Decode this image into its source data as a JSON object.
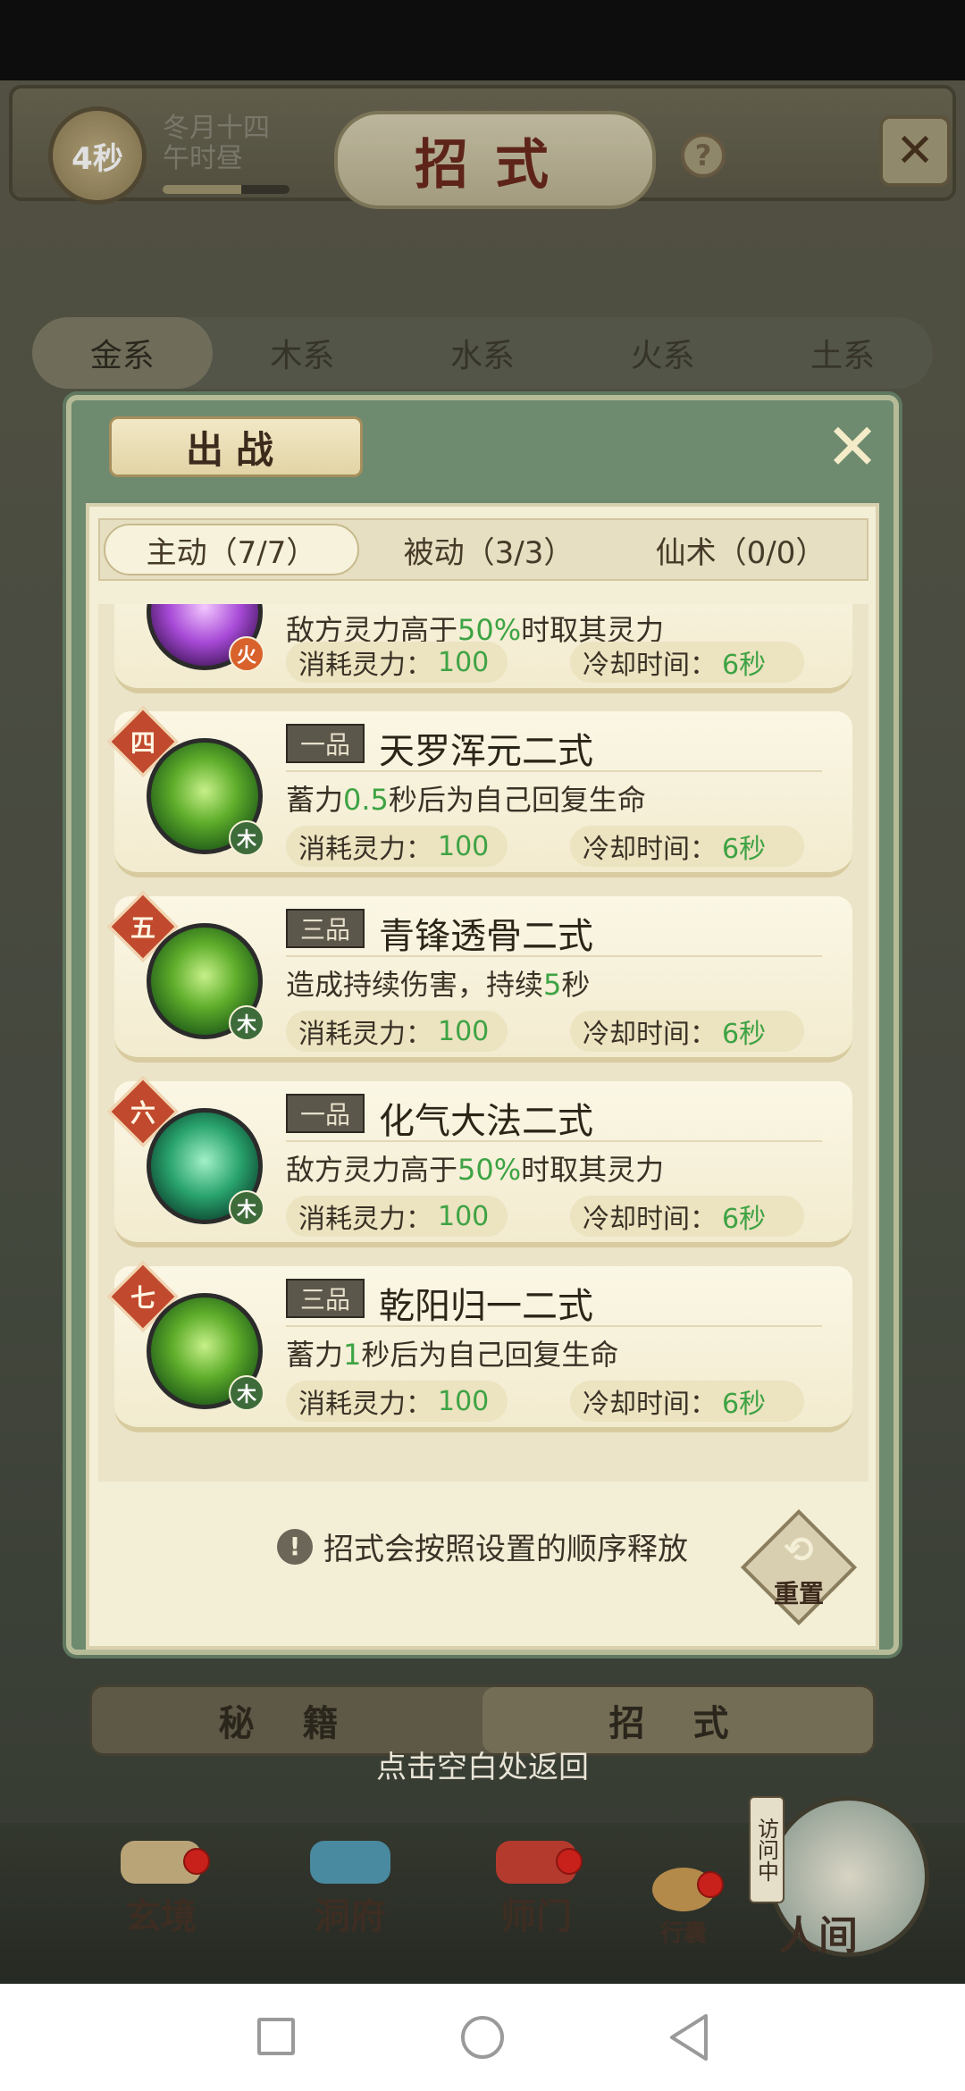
{
  "header": {
    "timer": "4秒",
    "date_line1": "冬月十四",
    "date_line2": "午时昼",
    "progress": 0.62,
    "title": "招式",
    "help": "?",
    "close": "✕"
  },
  "element_tabs": [
    "金系",
    "木系",
    "水系",
    "火系",
    "土系"
  ],
  "modal": {
    "title": "出战",
    "close": "✕",
    "sub_tabs": [
      "主动（7/7）",
      "被动（3/3）",
      "仙术（0/0）"
    ],
    "skills": [
      {
        "order": "",
        "grade": "",
        "name": "",
        "desc_pre": "敌方灵力高于",
        "desc_num": "50%",
        "desc_post": "时取其灵力",
        "element": "火",
        "cost_label": "消耗灵力：",
        "cost": "100",
        "cool_label": "冷却时间：",
        "cool": "6秒",
        "icon": "purple-vortex-icon"
      },
      {
        "order": "四",
        "grade": "一品",
        "name": "天罗浑元二式",
        "desc_pre": "蓄力",
        "desc_num": "0.5",
        "desc_post": "秒后为自己回复生命",
        "element": "木",
        "cost_label": "消耗灵力：",
        "cost": "100",
        "cool_label": "冷却时间：",
        "cool": "6秒",
        "icon": "palm-strike-icon"
      },
      {
        "order": "五",
        "grade": "三品",
        "name": "青锋透骨二式",
        "desc_pre": "造成持续伤害，持续",
        "desc_num": "5",
        "desc_post": "秒",
        "element": "木",
        "cost_label": "消耗灵力：",
        "cost": "100",
        "cool_label": "冷却时间：",
        "cool": "6秒",
        "icon": "green-blade-icon"
      },
      {
        "order": "六",
        "grade": "一品",
        "name": "化气大法二式",
        "desc_pre": "敌方灵力高于",
        "desc_num": "50%",
        "desc_post": "时取其灵力",
        "element": "木",
        "cost_label": "消耗灵力：",
        "cost": "100",
        "cool_label": "冷却时间：",
        "cool": "6秒",
        "icon": "green-scroll-icon"
      },
      {
        "order": "七",
        "grade": "三品",
        "name": "乾阳归一二式",
        "desc_pre": "蓄力",
        "desc_num": "1",
        "desc_post": "秒后为自己回复生命",
        "element": "木",
        "cost_label": "消耗灵力：",
        "cost": "100",
        "cool_label": "冷却时间：",
        "cool": "6秒",
        "icon": "green-flame-figure-icon"
      }
    ],
    "tip_icon": "!",
    "tip": "招式会按照设置的顺序释放",
    "reset_label": "重置"
  },
  "bottom_tabs": [
    "秘 籍",
    "招 式"
  ],
  "hint": "点击空白处返回",
  "bottom_nav": {
    "xuanjing": "玄境",
    "dongfu": "洞府",
    "shimen": "师门",
    "xingnang": "行囊",
    "visit": "访问中",
    "renjian": "人间"
  },
  "colors": {
    "accent_green": "#3ea344",
    "order_badge": "#c14a2e",
    "modal_frame": "#6e8a6f"
  }
}
